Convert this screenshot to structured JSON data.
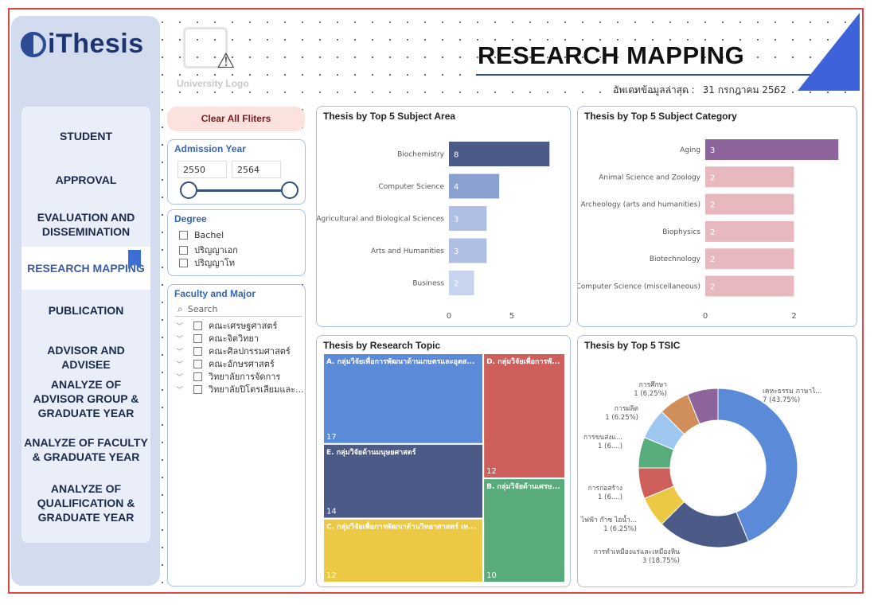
{
  "app": {
    "logo_text": "iThesis"
  },
  "sidebar": {
    "items": [
      {
        "label": "STUDENT"
      },
      {
        "label": "APPROVAL"
      },
      {
        "label": "EVALUATION AND DISSEMINATION"
      },
      {
        "label": "RESEARCH MAPPING"
      },
      {
        "label": "PUBLICATION"
      },
      {
        "label": "ADVISOR AND ADVISEE"
      },
      {
        "label": "ANALYZE OF ADVISOR GROUP & GRADUATE YEAR"
      },
      {
        "label": "ANALYZE OF FACULTY & GRADUATE YEAR"
      },
      {
        "label": "ANALYZE OF QUALIFICATION & GRADUATE YEAR"
      }
    ],
    "active": "RESEARCH MAPPING"
  },
  "header": {
    "university_logo_label": "University Logo",
    "title": "RESEARCH MAPPING",
    "update_label": "อัพเดทข้อมูลล่าสุด :",
    "update_date": "31 กรกฎาคม 2562"
  },
  "filters": {
    "clear_label": "Clear All Fliters",
    "admission_year": {
      "title": "Admission Year",
      "from": "2550",
      "to": "2564"
    },
    "degree": {
      "title": "Degree",
      "options": [
        "Bachel",
        "ปริญญาเอก",
        "ปริญญาโท"
      ]
    },
    "faculty": {
      "title": "Faculty and Major",
      "search_placeholder": "Search",
      "items": [
        "คณะเศรษฐศาสตร์",
        "คณะจิตวิทยา",
        "คณะศิลปกรรมศาสตร์",
        "คณะอักษรศาสตร์",
        "วิทยาลัยการจัดการ",
        "วิทยาลัยปิโตรเลียมและ..."
      ]
    }
  },
  "colors": {
    "accent": "#3d62d9",
    "brand": "#1e3470",
    "active_nav": "#3b5ca6"
  },
  "chart_data": [
    {
      "type": "bar",
      "title": "Thesis by Top 5 Subject Area",
      "categories": [
        "Biochemistry",
        "Computer Science",
        "Agricultural and Biological Sciences",
        "Arts and Humanities",
        "Business"
      ],
      "values": [
        8,
        4,
        3,
        3,
        2
      ],
      "colors": [
        "#4c5a88",
        "#8aa0cf",
        "#aebfe3",
        "#aebfe3",
        "#c8d4ee"
      ],
      "xticks": [
        0,
        5
      ],
      "xlim": [
        0,
        9.5
      ]
    },
    {
      "type": "bar",
      "title": "Thesis by Top 5 Subject Category",
      "categories": [
        "Aging",
        "Animal Science and Zoology",
        "Archeology (arts and humanities)",
        "Biophysics",
        "Biotechnology",
        "Computer Science (miscellaneous)"
      ],
      "values": [
        3,
        2,
        2,
        2,
        2,
        2
      ],
      "colors": [
        "#8d659c",
        "#e8b8bf",
        "#e8b8bf",
        "#e8b8bf",
        "#e8b8bf",
        "#e8b8bf"
      ],
      "xticks": [
        0,
        2
      ],
      "xlim": [
        0,
        3.3
      ]
    },
    {
      "type": "treemap",
      "title": "Thesis by Research Topic",
      "items": [
        {
          "label": "A. กลุ่มวิจัยเพื่อการพัฒนาด้านเกษตรและอุตส...",
          "value": 17,
          "color": "#5b8ad9"
        },
        {
          "label": "D. กลุ่มวิจัยเพื่อการพั...",
          "value": 12,
          "color": "#cf5f5a"
        },
        {
          "label": "E. กลุ่มวิจัยด้านมนุษยศาสตร์",
          "value": 14,
          "color": "#4c5a88"
        },
        {
          "label": "B. กลุ่มวิจัยด้านเศรษ...",
          "value": 10,
          "color": "#58ab7a"
        },
        {
          "label": "C. กลุ่มวิจัยเพื่อการพัฒนาด้านวิทยาศาสตร์ เท...",
          "value": 12,
          "color": "#ebc944"
        }
      ]
    },
    {
      "type": "pie",
      "title": "Thesis by Top 5 TSIC",
      "slices": [
        {
          "label": "เคหะธรรม ภาษาไ...",
          "value": 7,
          "pct": "7 (43.75%)",
          "color": "#5b8ad9"
        },
        {
          "label": "การทำเหมืองแร่และเหมืองหิน",
          "value": 3,
          "pct": "3 (18.75%)",
          "color": "#4c5a88"
        },
        {
          "label": "ไฟฟ้า ก๊าซ ไอน้ำ...",
          "value": 1,
          "pct": "1 (6.25%)",
          "color": "#ebc944"
        },
        {
          "label": "การก่อสร้าง",
          "value": 1,
          "pct": "1 (6....)",
          "color": "#cf5f5a"
        },
        {
          "label": "การขนส่งแ...",
          "value": 1,
          "pct": "1 (6....)",
          "color": "#58ab7a"
        },
        {
          "label": "การผลิต",
          "value": 1,
          "pct": "1 (6.25%)",
          "color": "#9ec7ef"
        },
        {
          "label": "การศึกษา",
          "value": 1,
          "pct": "1 (6.25%)",
          "color": "#d08f5a"
        },
        {
          "label": "",
          "value": 1,
          "pct": "",
          "color": "#8d659c"
        }
      ]
    }
  ]
}
